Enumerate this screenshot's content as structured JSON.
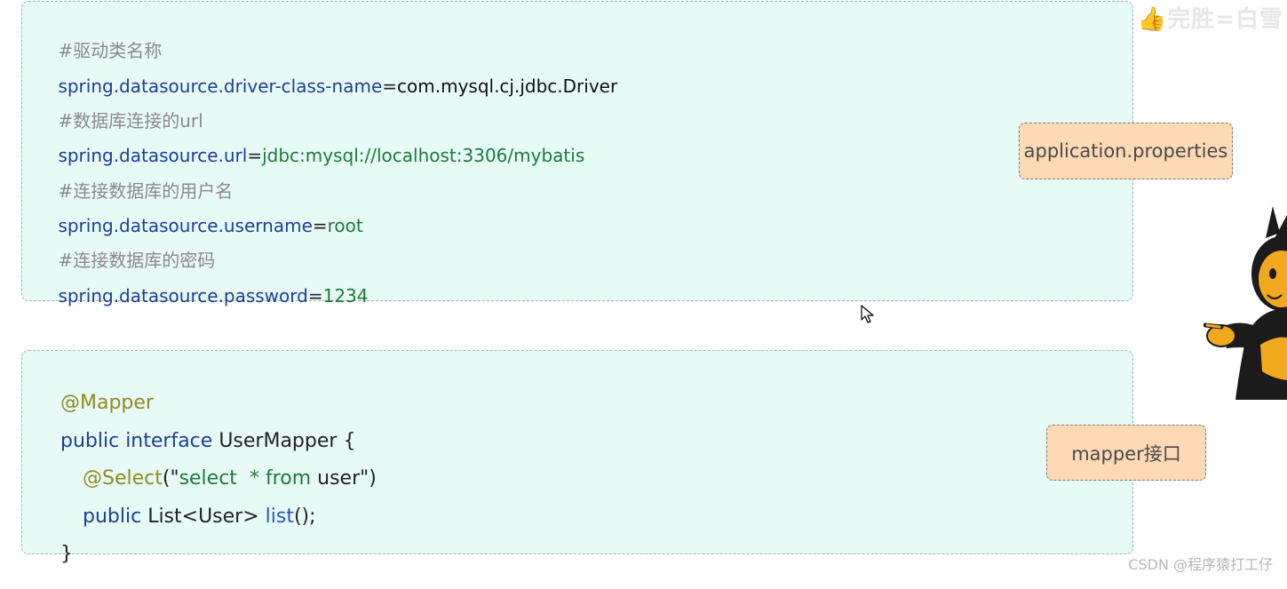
{
  "properties_box": {
    "line1": {
      "comment": "#驱动类名称"
    },
    "line2": {
      "key": "spring.datasource.driver-class-name",
      "eq": "=",
      "value": "com.mysql.cj.jdbc.Driver"
    },
    "line3": {
      "comment": "#数据库连接的url"
    },
    "line4": {
      "key": "spring.datasource.url",
      "eq": "=",
      "value": "jdbc:mysql://localhost:3306/mybatis"
    },
    "line5": {
      "comment": "#连接数据库的用户名"
    },
    "line6": {
      "key": "spring.datasource.username",
      "eq": "=",
      "value": "root"
    },
    "line7": {
      "comment": "#连接数据库的密码"
    },
    "line8": {
      "key": "spring.datasource.password",
      "eq": "=",
      "value": "1234"
    }
  },
  "mapper_box": {
    "line1": {
      "annotation": "@Mapper"
    },
    "line2": {
      "kw1": "public",
      "kw2": "interface",
      "name": "UserMapper",
      "brace": "{"
    },
    "line3": {
      "annotation": "@Select",
      "open": "(\"",
      "sql_kw1": "select",
      "star": "*",
      "sql_kw2": "from",
      "table": "user",
      "close": "\")"
    },
    "line4": {
      "kw": "public",
      "type": "List<User>",
      "method": "list",
      "end": "();"
    },
    "line5": {
      "brace": "}"
    }
  },
  "tags": {
    "properties": "application.properties",
    "mapper": "mapper接口"
  },
  "watermarks": {
    "top": "完胜=白雪",
    "bottom": "CSDN @程序猿打工仔"
  },
  "icons": {
    "cursor": "mouse-pointer-icon",
    "mascot": "pointing-mascot-illustration",
    "thumb": "thumbs-up-icon"
  },
  "colors": {
    "box_background": "#e6faf6",
    "tag_background": "#fdd9b5",
    "property_key": "#1f3f93",
    "string_value": "#1f7a3a",
    "comment": "#8a8a8a",
    "annotation": "#948a20"
  }
}
